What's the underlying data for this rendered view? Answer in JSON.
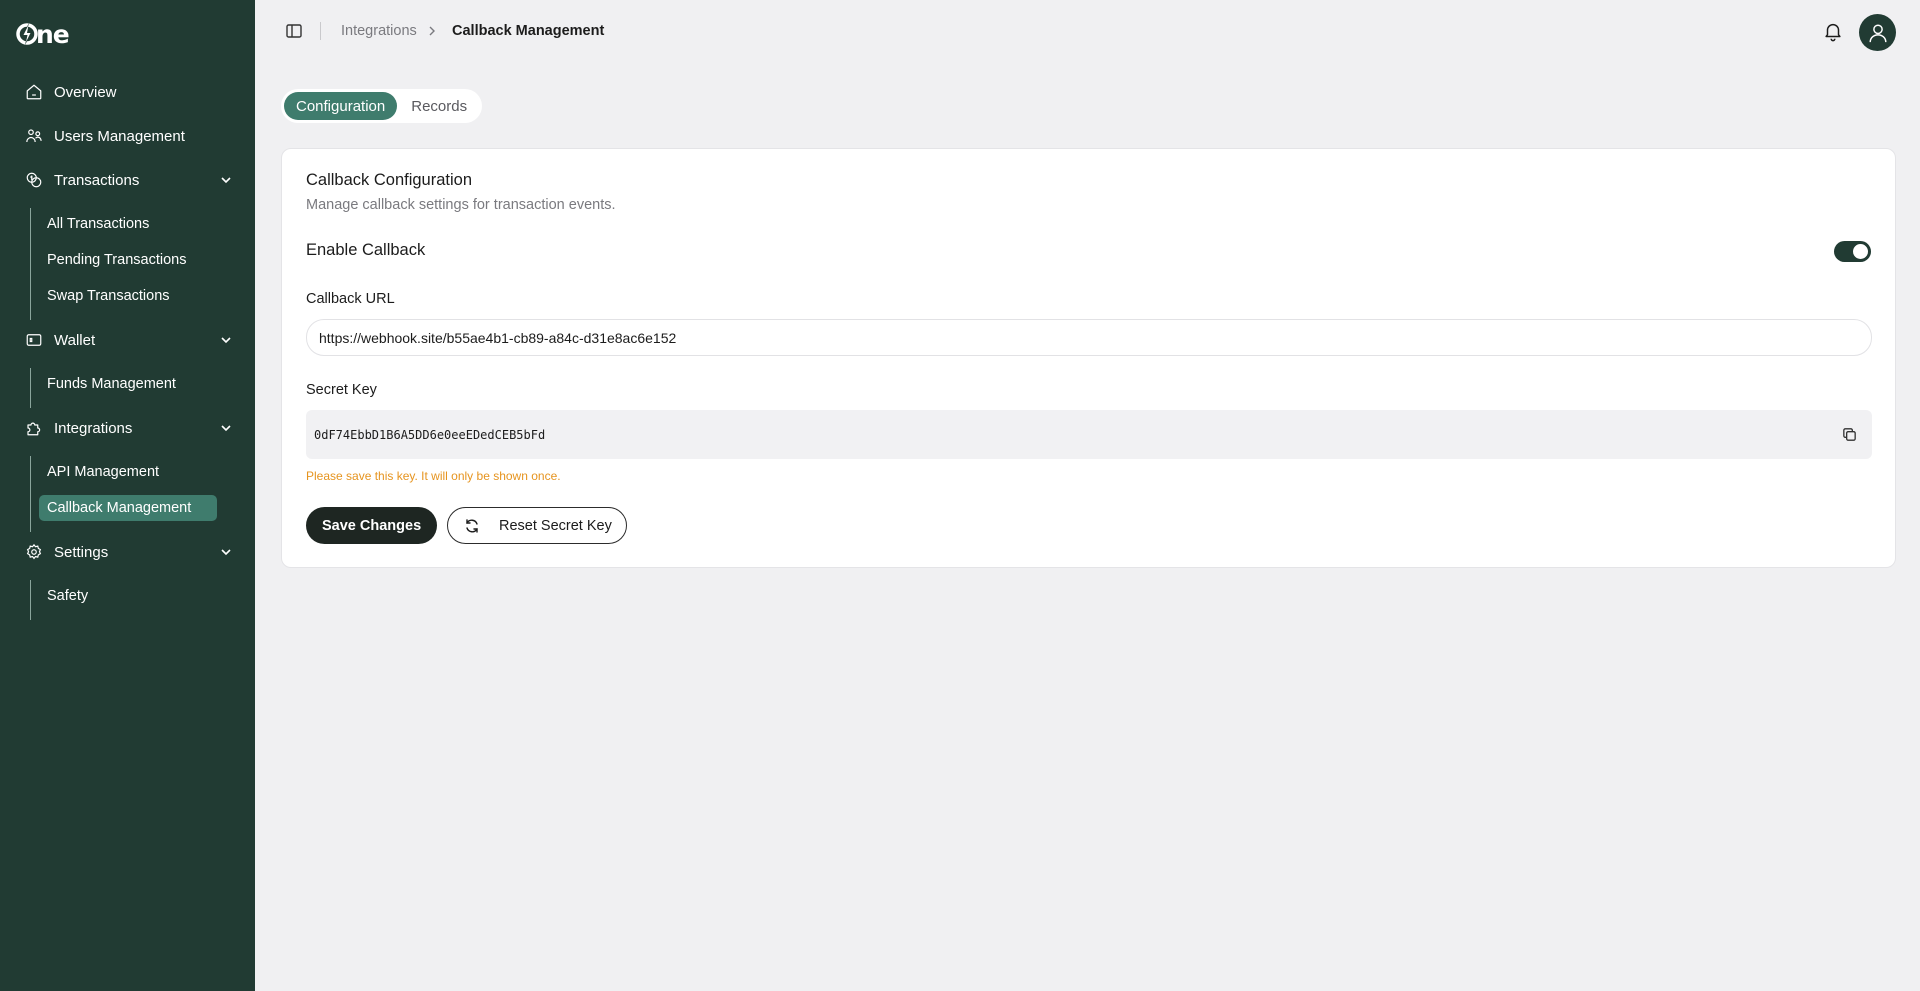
{
  "app": {
    "logo_text": "ne"
  },
  "sidebar": {
    "overview": "Overview",
    "users": "Users Management",
    "transactions": {
      "label": "Transactions",
      "items": [
        "All Transactions",
        "Pending Transactions",
        "Swap Transactions"
      ]
    },
    "wallet": {
      "label": "Wallet",
      "items": [
        "Funds Management"
      ]
    },
    "integrations": {
      "label": "Integrations",
      "items": [
        "API Management",
        "Callback Management"
      ],
      "active": "Callback Management"
    },
    "settings": {
      "label": "Settings",
      "items": [
        "Safety"
      ]
    }
  },
  "header": {
    "breadcrumb": [
      "Integrations",
      "Callback Management"
    ]
  },
  "tabs": [
    {
      "label": "Configuration",
      "active": true
    },
    {
      "label": "Records",
      "active": false
    }
  ],
  "card": {
    "title": "Callback Configuration",
    "subtitle": "Manage callback settings for transaction events.",
    "enable_label": "Enable Callback",
    "enabled": true,
    "url_label": "Callback URL",
    "url_value": "https://webhook.site/b55ae4b1-cb89-a84c-d31e8ac6e152",
    "key_label": "Secret Key",
    "key_value": "0dF74EbbD1B6A5DD6e0eeEDedCEB5bFd",
    "warning": "Please save this key. It will only be shown once.",
    "save_label": "Save Changes",
    "reset_label": "Reset Secret Key"
  },
  "colors": {
    "sidebar_bg": "#213b33",
    "accent": "#3f7c6d",
    "warning": "#e6941f",
    "primary_button": "#1e2622"
  }
}
